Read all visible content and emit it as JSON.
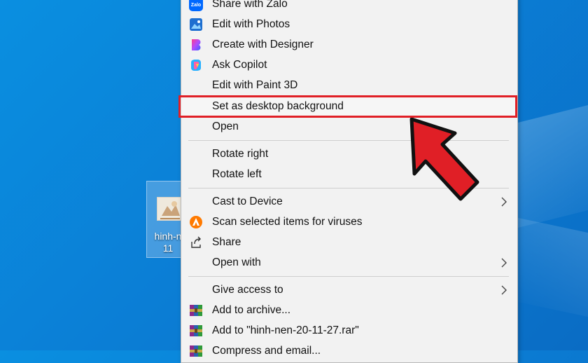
{
  "desktop": {
    "icon_label_line1": "hinh-n",
    "icon_label_line2": "11"
  },
  "context_menu": {
    "items": [
      {
        "label": "Share with Zalo",
        "icon": "zalo-icon"
      },
      {
        "label": "Edit with Photos",
        "icon": "photos-icon"
      },
      {
        "label": "Create with Designer",
        "icon": "designer-icon"
      },
      {
        "label": "Ask Copilot",
        "icon": "copilot-icon"
      },
      {
        "label": "Edit with Paint 3D",
        "icon": ""
      },
      {
        "label": "Set as desktop background",
        "icon": "",
        "highlighted": true
      },
      {
        "label": "Open",
        "icon": ""
      },
      {
        "label": "Rotate right",
        "icon": ""
      },
      {
        "label": "Rotate left",
        "icon": ""
      },
      {
        "label": "Cast to Device",
        "icon": "",
        "submenu": true
      },
      {
        "label": "Scan selected items for viruses",
        "icon": "avast-icon"
      },
      {
        "label": "Share",
        "icon": "share-icon"
      },
      {
        "label": "Open with",
        "icon": "",
        "submenu": true
      },
      {
        "label": "Give access to",
        "icon": "",
        "submenu": true
      },
      {
        "label": "Add to archive...",
        "icon": "winrar-icon"
      },
      {
        "label": "Add to \"hinh-nen-20-11-27.rar\"",
        "icon": "winrar-icon"
      },
      {
        "label": "Compress and email...",
        "icon": "winrar-icon"
      }
    ],
    "zalo_icon_text": "Zalo"
  },
  "colors": {
    "highlight_border": "#e01f26",
    "arrow_fill": "#e01f26",
    "wallpaper": "#0b7fd6"
  }
}
